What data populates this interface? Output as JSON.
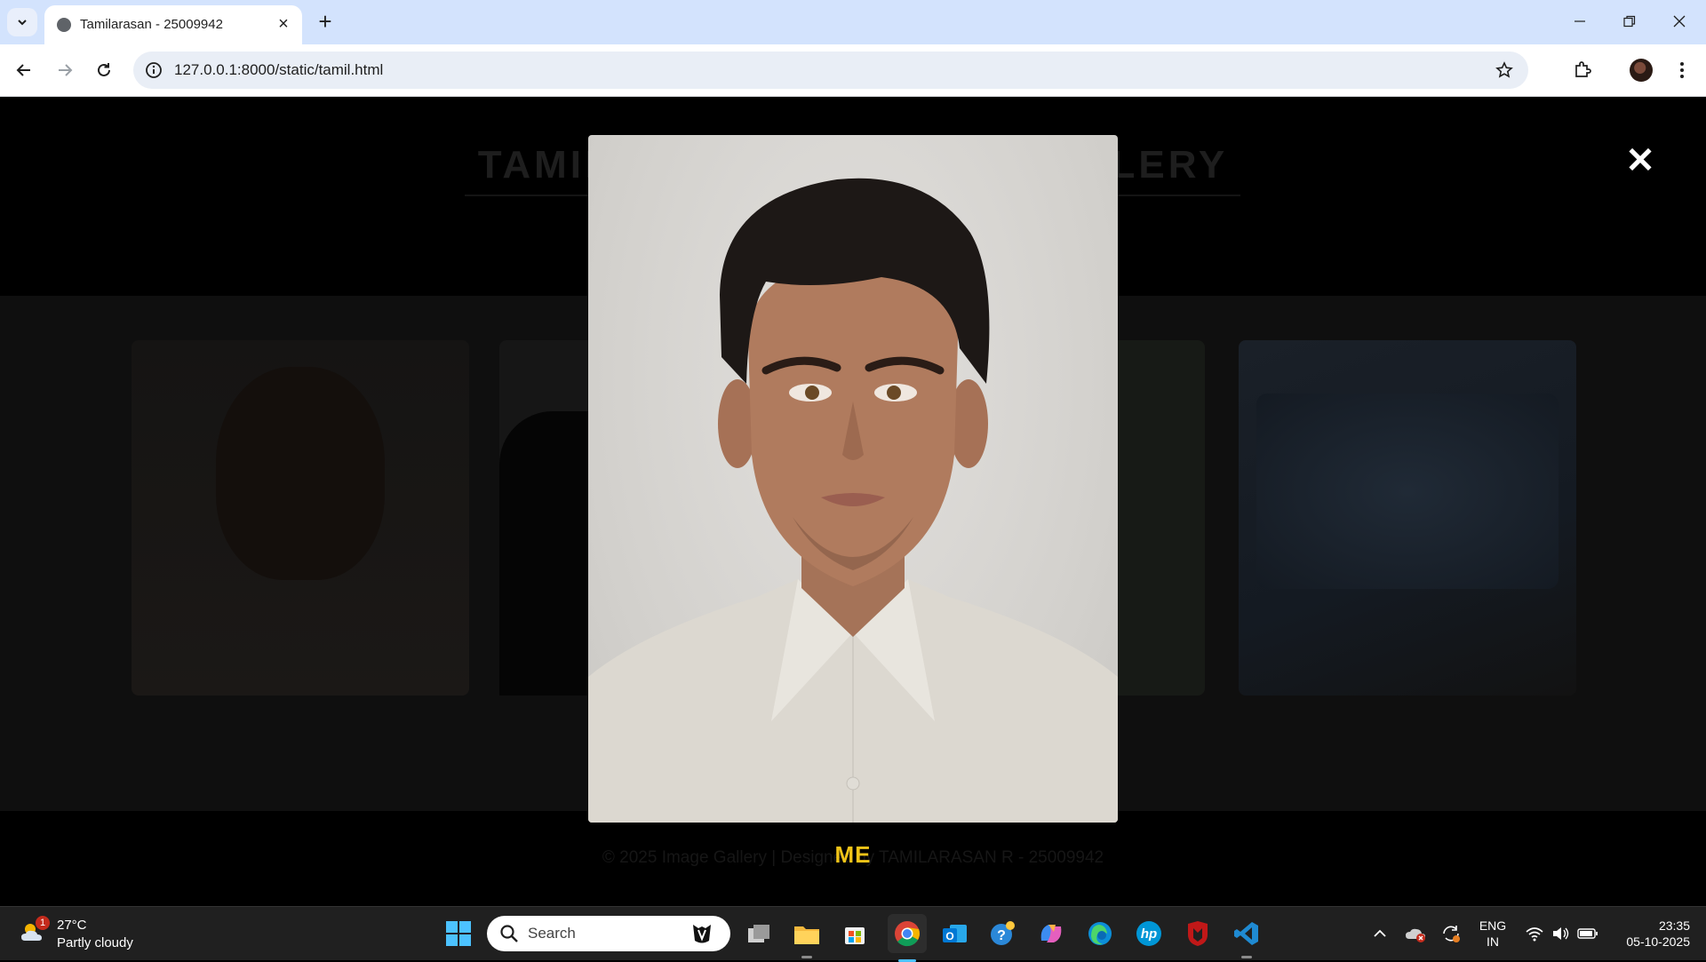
{
  "browser": {
    "tab_title": "Tamilarasan - 25009942",
    "url": "127.0.0.1:8000/static/tamil.html"
  },
  "page": {
    "title": "TAMILARASAN'S IMAGE GALLERY",
    "footer": "© 2025 Image Gallery | Designed by TAMILARASAN R - 25009942"
  },
  "lightbox": {
    "close_glyph": "✕",
    "caption": "ME"
  },
  "taskbar": {
    "weather_badge": "1",
    "weather_temp": "27°C",
    "weather_condition": "Partly cloudy",
    "search_placeholder": "Search",
    "lang_line1": "ENG",
    "lang_line2": "IN",
    "time": "23:35",
    "date": "05-10-2025"
  },
  "colors": {
    "caption": "#f2c418",
    "tabstrip": "#d3e3fd",
    "taskbar": "#202020",
    "accent": "#4cc2ff"
  }
}
